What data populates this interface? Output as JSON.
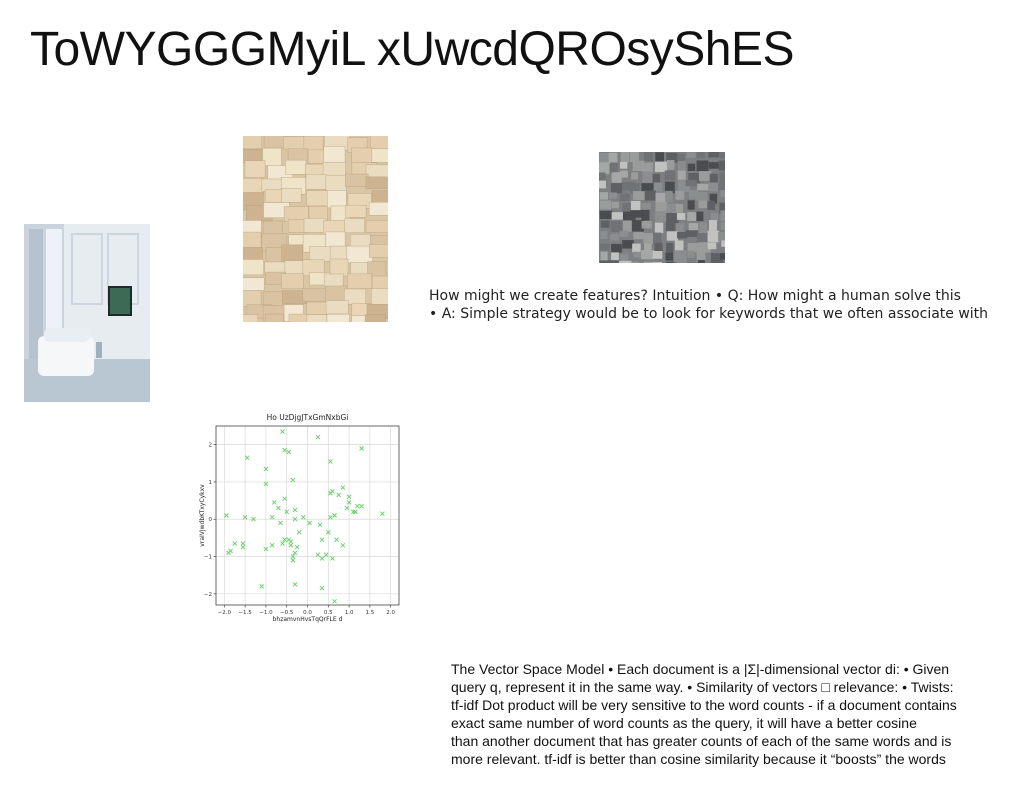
{
  "slide": {
    "title": "ToWYGGGMyiL xUwcdQROsyShES",
    "intuition_lines": [
      "How might we create features? Intuition • Q: How might a human solve this",
      "• A: Simple strategy would be to look for keywords that we often associate with"
    ],
    "vsm_lines": [
      "The Vector Space Model • Each document is a |Σ|-dimensional vector di: • Given",
      "query q, represent it in the same way. • Similarity of vectors □ relevance: • Twists:",
      "tf-idf Dot product will be very sensitive to the word counts - if a document contains",
      "exact same number of word counts as the query, it will have a better cosine",
      "than another document that has greater counts of each of the same words and is",
      "more relevant. tf-idf is better than cosine similarity because it “boosts” the words"
    ]
  },
  "images": {
    "room": "interior-room-photo",
    "sticky": "sticky-notes-wall-photo",
    "city": "stone-city-photo"
  },
  "colors": {
    "marker": "#5fd35f",
    "grid": "#d9d9d9",
    "text": "#111111"
  },
  "chart_data": {
    "type": "scatter",
    "title": "Ho UzDjgJTxGmNxbGi",
    "xlabel": "bhzamvnHvsTqQrFLE d",
    "ylabel": "vraIVJwdbKTxyCykxv",
    "xlim": [
      -2.2,
      2.2
    ],
    "ylim": [
      -2.3,
      2.5
    ],
    "xticks": [
      -2.0,
      -1.5,
      -1.0,
      -0.5,
      0.0,
      0.5,
      1.0,
      1.5,
      2.0
    ],
    "yticks": [
      -2,
      -1,
      0,
      1,
      2
    ],
    "xtick_labels": [
      "−2.0",
      "−1.5",
      "−1.0",
      "−0.5",
      "0.0",
      "0.5",
      "1.0",
      "1.5",
      "2.0"
    ],
    "ytick_labels": [
      "−2",
      "−1",
      "0",
      "1",
      "2"
    ],
    "grid": true,
    "marker": "x",
    "x": [
      -0.6,
      0.25,
      -0.55,
      -0.45,
      -1.45,
      0.55,
      1.3,
      -1.0,
      -1.0,
      -0.35,
      0.85,
      -0.8,
      -0.55,
      0.6,
      0.55,
      1.0,
      0.75,
      1.2,
      -0.7,
      1.0,
      -0.85,
      -1.95,
      -0.5,
      -0.3,
      -0.3,
      0.95,
      1.8,
      1.15,
      1.3,
      1.15,
      1.1,
      -1.5,
      -1.3,
      -0.65,
      -0.2,
      0.05,
      -0.45,
      0.3,
      0.5,
      0.35,
      0.7,
      -0.6,
      -0.55,
      -0.4,
      -0.85,
      -1.85,
      -1.9,
      -1.75,
      -1.55,
      -1.55,
      -1.0,
      0.85,
      -0.35,
      -0.3,
      -0.35,
      -0.25,
      0.45,
      0.6,
      0.35,
      0.25,
      0.55,
      0.65,
      -0.4,
      -1.1,
      0.35,
      0.65,
      -0.3,
      -0.1
    ],
    "y": [
      2.35,
      2.2,
      1.85,
      1.8,
      1.65,
      1.55,
      1.9,
      1.35,
      0.95,
      1.05,
      0.85,
      0.45,
      0.55,
      0.75,
      0.7,
      0.6,
      0.65,
      0.35,
      0.3,
      0.45,
      0.05,
      0.1,
      0.2,
      0.25,
      0.0,
      0.3,
      0.15,
      0.2,
      0.35,
      0.2,
      0.2,
      0.05,
      0.0,
      -0.1,
      -0.35,
      -0.1,
      -0.55,
      -0.15,
      -0.35,
      -0.55,
      -0.55,
      -0.65,
      -0.55,
      -0.7,
      -0.7,
      -0.85,
      -0.9,
      -0.65,
      -0.75,
      -0.65,
      -0.8,
      -0.7,
      -1.0,
      -0.9,
      -1.1,
      -0.75,
      -0.95,
      -1.05,
      -1.05,
      -0.95,
      0.05,
      0.1,
      -0.6,
      -1.8,
      -1.85,
      -2.2,
      -1.75,
      0.05
    ]
  }
}
